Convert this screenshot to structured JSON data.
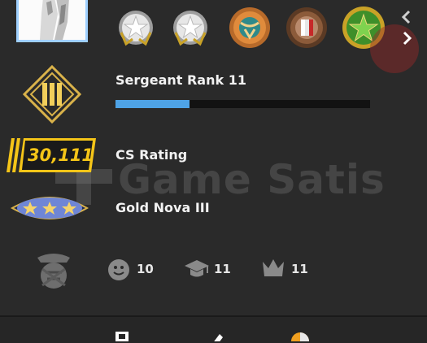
{
  "profile": {
    "rank_title": "Sergeant Rank 11",
    "xp_progress": 0.29,
    "cs_rating": "30,111",
    "cs_rating_label": "CS Rating",
    "competitive_rank": "Gold Nova III",
    "watermark": "Game Satis"
  },
  "commendations": {
    "friendly": "10",
    "teacher": "11",
    "leader": "11"
  },
  "colors": {
    "xp_fill": "#4ea3e6",
    "rating_badge": "#f5c518",
    "background": "#2a2a2a"
  },
  "medals": [
    "silver-coin-medal-icon",
    "silver-coin-medal-icon",
    "orange-bull-medal-icon",
    "bronze-flag-medal-icon",
    "green-star-medal-icon"
  ]
}
